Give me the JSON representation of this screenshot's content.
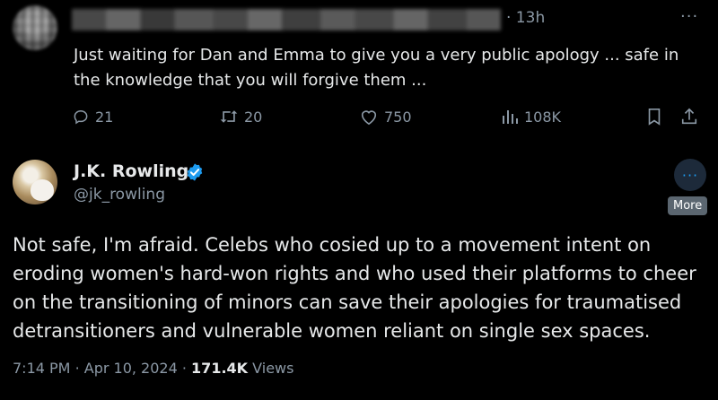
{
  "reply": {
    "time": "· 13h",
    "more": "···",
    "text": "Just waiting for Dan and Emma to give you a very public apology ... safe in the knowledge that you will forgive them ...",
    "stats": {
      "replies": "21",
      "retweets": "20",
      "likes": "750",
      "views": "108K"
    },
    "icons": {
      "reply": "reply-icon",
      "retweet": "retweet-icon",
      "like": "heart-icon",
      "views": "views-icon",
      "bookmark": "bookmark-icon",
      "share": "share-icon"
    }
  },
  "tweet": {
    "author_name": "J.K. Rowling",
    "handle": "@jk_rowling",
    "more_tooltip": "More",
    "more": "···",
    "text": "Not safe, I'm afraid. Celebs who cosied up to a movement intent on eroding women's hard-won rights and who used their platforms to cheer on the transitioning of minors can save their apologies for traumatised detransitioners and vulnerable women reliant on single sex spaces.",
    "time": "7:14 PM",
    "date": "Apr 10, 2024",
    "views_count": "171.4K",
    "views_label": "Views",
    "separator": "·"
  },
  "colors": {
    "background": "#000000",
    "text": "#e7e9ea",
    "secondary": "#8b98a5",
    "verified": "#1d9bf0"
  }
}
